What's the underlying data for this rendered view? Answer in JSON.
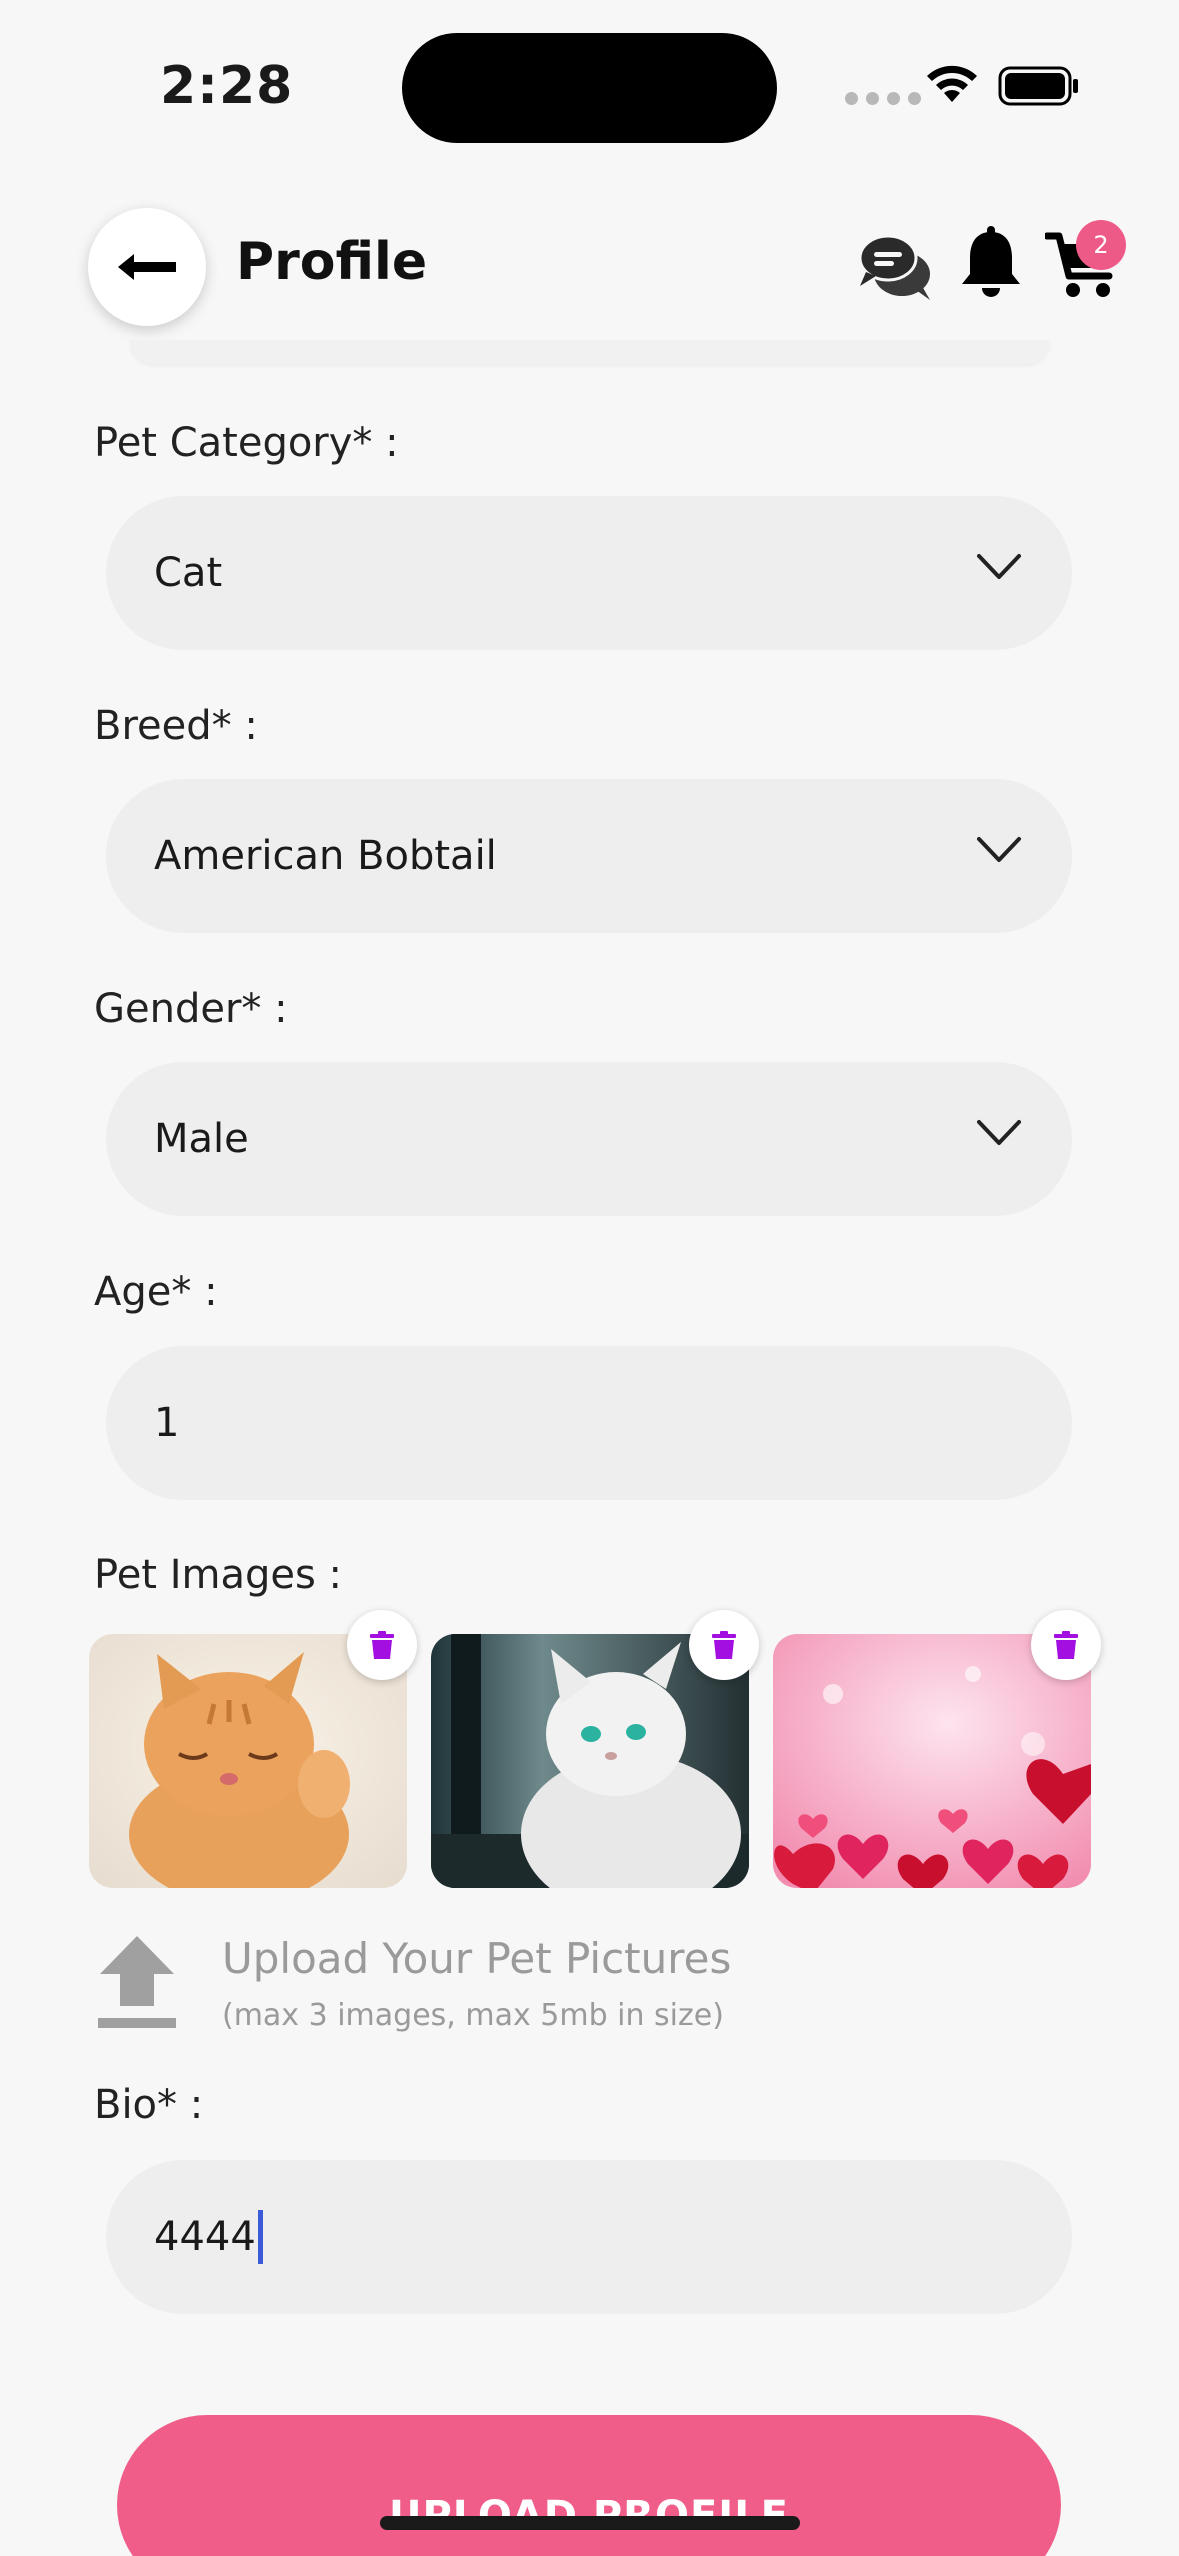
{
  "status_bar": {
    "time": "2:28"
  },
  "header": {
    "title": "Profile",
    "cart_count": "2",
    "icons": [
      "back-arrow-icon",
      "chat-icon",
      "bell-icon",
      "cart-icon"
    ]
  },
  "form": {
    "pet_category": {
      "label": "Pet Category* :",
      "value": "Cat"
    },
    "breed": {
      "label": "Breed* :",
      "value": "American Bobtail"
    },
    "gender": {
      "label": "Gender* :",
      "value": "Male"
    },
    "age": {
      "label": "Age* :",
      "value": "1"
    },
    "pet_images": {
      "label": "Pet Images :"
    },
    "upload": {
      "title": "Upload Your Pet Pictures",
      "hint": "(max 3 images, max 5mb in size)"
    },
    "bio": {
      "label": "Bio* :",
      "value": "4444"
    }
  },
  "submit_label": "UPLOAD PROFILE",
  "colors": {
    "accent": "#ef5d88",
    "delete_icon": "#a20fe0",
    "field_bg": "#eeeeee",
    "cursor": "#3b5bdb"
  }
}
